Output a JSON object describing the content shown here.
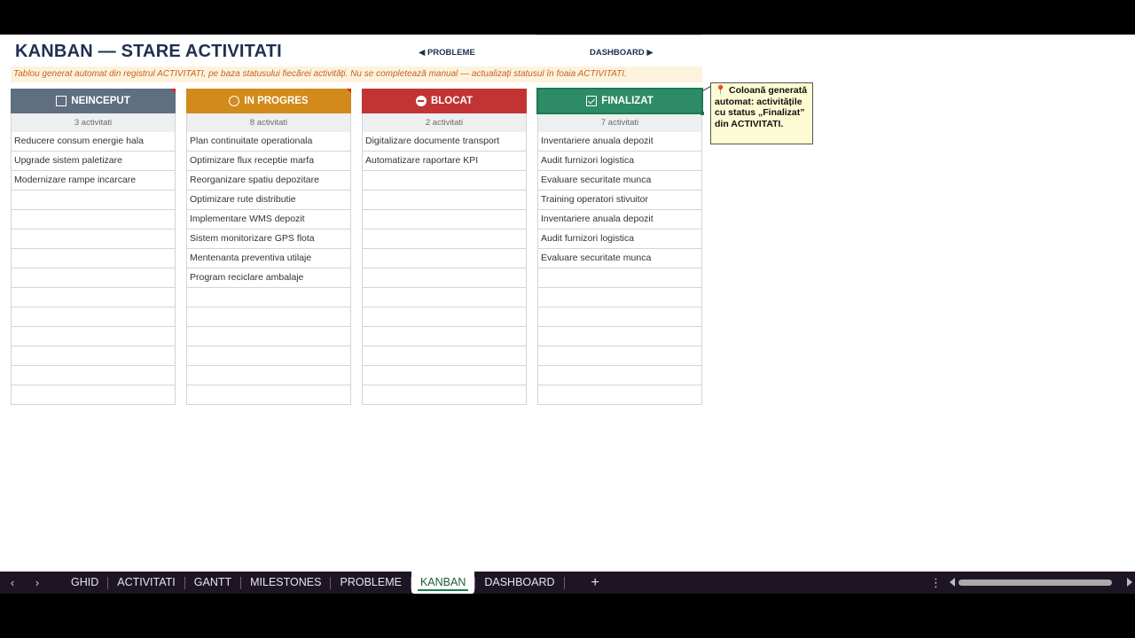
{
  "page": {
    "title": "KANBAN — STARE ACTIVITATI",
    "nav_prev": "◀ PROBLEME",
    "nav_next": "DASHBOARD ▶",
    "subtitle": "Tablou generat automat din registrul ACTIVITATI, pe baza statusului fiecărei activități. Nu se completează manual — actualizați statusul în foaia ACTIVITATI."
  },
  "colors": {
    "neinceput": "#5f6e80",
    "in_progres": "#d28a1a",
    "blocat": "#c23434",
    "finalizat": "#2e8b68"
  },
  "columns": [
    {
      "key": "neinceput",
      "title": "NEINCEPUT",
      "icon": "checkbox-empty-icon",
      "count": "3 activitati",
      "items": [
        "Reducere consum energie hala",
        "Upgrade sistem paletizare",
        "Modernizare rampe incarcare",
        "",
        "",
        "",
        "",
        "",
        "",
        "",
        "",
        "",
        "",
        ""
      ]
    },
    {
      "key": "in_progres",
      "title": "IN PROGRES",
      "icon": "circle-icon",
      "count": "8 activitati",
      "items": [
        "Plan continuitate operationala",
        "Optimizare flux receptie marfa",
        "Reorganizare spatiu depozitare",
        "Optimizare rute distributie",
        "Implementare WMS depozit",
        "Sistem monitorizare GPS flota",
        "Mentenanta preventiva utilaje",
        "Program reciclare ambalaje",
        "",
        "",
        "",
        "",
        "",
        ""
      ]
    },
    {
      "key": "blocat",
      "title": "BLOCAT",
      "icon": "no-entry-icon",
      "count": "2 activitati",
      "items": [
        "Digitalizare documente transport",
        "Automatizare raportare KPI",
        "",
        "",
        "",
        "",
        "",
        "",
        "",
        "",
        "",
        "",
        "",
        ""
      ]
    },
    {
      "key": "finalizat",
      "title": "FINALIZAT",
      "icon": "checkbox-checked-icon",
      "count": "7 activitati",
      "items": [
        "Inventariere anuala depozit",
        "Audit furnizori logistica",
        "Evaluare securitate munca",
        "Training operatori stivuitor",
        "Inventariere anuala depozit",
        "Audit furnizori logistica",
        "Evaluare securitate munca",
        "",
        "",
        "",
        "",
        "",
        "",
        ""
      ]
    }
  ],
  "note": {
    "icon": "pin-icon",
    "text": "Coloană generată automat: activitățile cu status „Finalizat” din ACTIVITATI."
  },
  "tabs": [
    "GHID",
    "ACTIVITATI",
    "GANTT",
    "MILESTONES",
    "PROBLEME",
    "KANBAN",
    "DASHBOARD"
  ],
  "active_tab": "KANBAN",
  "tab_add": "+"
}
